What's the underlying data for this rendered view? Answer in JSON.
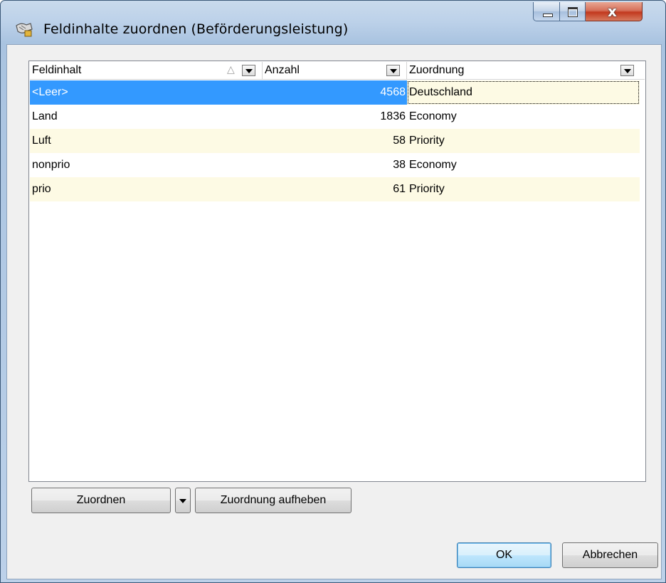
{
  "window": {
    "title": "Feldinhalte zuordnen (Beförderungsleistung)",
    "icon": "mapping-app-icon",
    "close_glyph": "x"
  },
  "grid": {
    "columns": [
      {
        "label": "Feldinhalt",
        "sort": "ascending"
      },
      {
        "label": "Anzahl"
      },
      {
        "label": "Zuordnung"
      }
    ],
    "rows": [
      {
        "feldinhalt": "<Leer>",
        "anzahl": "4568",
        "zuordnung": "Deutschland",
        "state": "selected"
      },
      {
        "feldinhalt": "Land",
        "anzahl": "1836",
        "zuordnung": "Economy"
      },
      {
        "feldinhalt": "Luft",
        "anzahl": "58",
        "zuordnung": "Priority"
      },
      {
        "feldinhalt": "nonprio",
        "anzahl": "38",
        "zuordnung": "Economy"
      },
      {
        "feldinhalt": "prio",
        "anzahl": "61",
        "zuordnung": "Priority"
      }
    ]
  },
  "buttons": {
    "assign": "Zuordnen",
    "unassign": "Zuordnung aufheben",
    "ok": "OK",
    "cancel": "Abbrechen"
  },
  "colors": {
    "selection": "#3399ff",
    "alt_row": "#fdfae4",
    "close_button": "#c2391e"
  }
}
